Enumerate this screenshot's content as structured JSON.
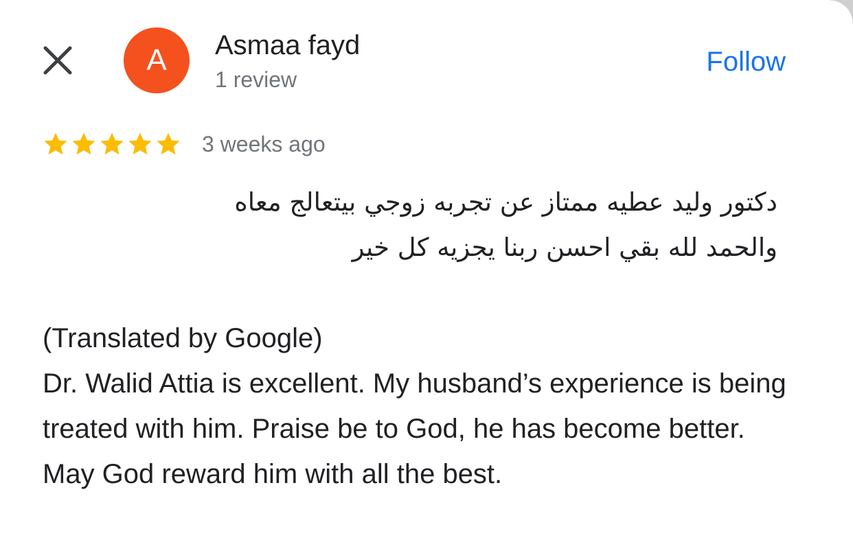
{
  "header": {
    "close_icon": "close-icon",
    "avatar_initial": "A",
    "avatar_color": "#f4511e",
    "user_name": "Asmaa fayd",
    "review_count": "1 review",
    "follow_label": "Follow",
    "follow_color": "#1a73e8"
  },
  "review": {
    "rating": 5,
    "max_rating": 5,
    "star_color": "#fbbc04",
    "date": "3 weeks ago",
    "original_text": "دكتور وليد عطيه ممتاز عن تجربه زوجي بيتعالج معاه\nوالحمد لله بقي احسن ربنا يجزيه كل خير",
    "translated_label": "(Translated by Google)",
    "translated_text": "Dr. Walid Attia is excellent. My husband’s experience is being treated with him. Praise be to God, he has become better. May God reward him with all the best."
  }
}
